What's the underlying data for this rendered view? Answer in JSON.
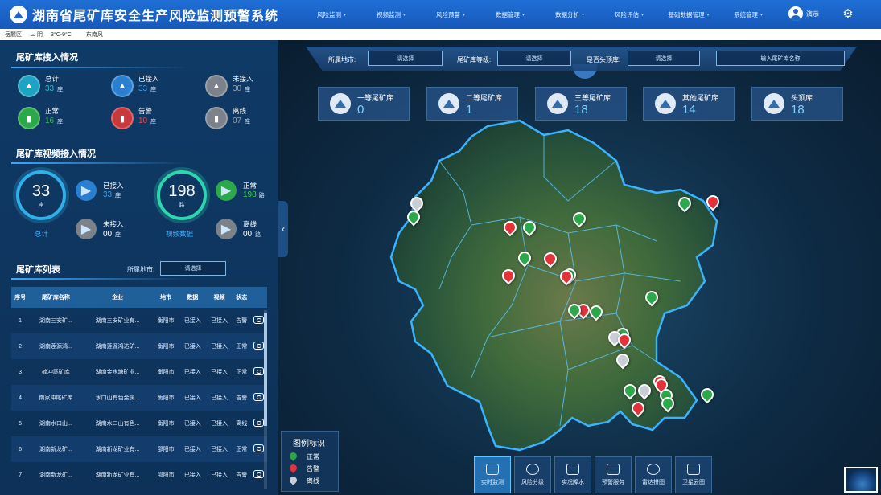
{
  "app": {
    "title": "湖南省尾矿库安全生产风险监测预警系统"
  },
  "nav": {
    "items": [
      {
        "label": "风险监测"
      },
      {
        "label": "视频监测"
      },
      {
        "label": "风险预警"
      },
      {
        "label": "数据管理"
      },
      {
        "label": "数据分析"
      },
      {
        "label": "风险评估"
      },
      {
        "label": "基础数据管理"
      },
      {
        "label": "系统管理"
      }
    ],
    "user": "演示"
  },
  "weather": {
    "region": "岳麓区",
    "condition": "阴",
    "temp": "3°C-9°C",
    "wind": "东南风"
  },
  "access": {
    "title": "尾矿库接入情况",
    "unit": "座",
    "stats": [
      {
        "label": "总计",
        "value": "33",
        "color": "#2fb8d6"
      },
      {
        "label": "已接入",
        "value": "33",
        "color": "#2a7fd0"
      },
      {
        "label": "未接入",
        "value": "30",
        "color": "#8a9099"
      },
      {
        "label": "正常",
        "value": "16",
        "color": "#2aa84a"
      },
      {
        "label": "告警",
        "value": "10",
        "color": "#c8383c"
      },
      {
        "label": "离线",
        "value": "07",
        "color": "#8a9099"
      }
    ]
  },
  "video": {
    "title": "尾矿库视频接入情况",
    "total_value": "33",
    "total_unit": "座",
    "total_label": "总计",
    "connected_label": "已接入",
    "connected_value": "33",
    "connected_unit": "座",
    "unconnected_label": "未接入",
    "unconnected_value": "00",
    "unconnected_unit": "座",
    "data_value": "198",
    "data_unit": "路",
    "data_label": "视频数据",
    "normal_label": "正常",
    "normal_value": "198",
    "normal_unit": "路",
    "offline_label": "离线",
    "offline_value": "00",
    "offline_unit": "路"
  },
  "list": {
    "title": "尾矿库列表",
    "filter_label": "所属地市:",
    "filter_placeholder": "请选择",
    "headers": [
      "序号",
      "尾矿库名称",
      "企业",
      "地市",
      "数据",
      "视频",
      "状态"
    ],
    "rows": [
      {
        "no": "1",
        "name": "湖南三安矿...",
        "company": "湖南三安矿业有...",
        "city": "衡阳市",
        "data": "已接入",
        "video": "已接入",
        "status": "告警"
      },
      {
        "no": "2",
        "name": "湖南莲源鸿...",
        "company": "湖南莲源鸿达矿...",
        "city": "衡阳市",
        "data": "已接入",
        "video": "已接入",
        "status": "正常"
      },
      {
        "no": "3",
        "name": "楠冲尾矿库",
        "company": "湖南金水塘矿业...",
        "city": "衡阳市",
        "data": "已接入",
        "video": "已接入",
        "status": "正常"
      },
      {
        "no": "4",
        "name": "南家冲尾矿库",
        "company": "水口山有色金属...",
        "city": "衡阳市",
        "data": "已接入",
        "video": "已接入",
        "status": "告警"
      },
      {
        "no": "5",
        "name": "湖南水口山...",
        "company": "湖南水口山有色...",
        "city": "衡阳市",
        "data": "已接入",
        "video": "已接入",
        "status": "离线"
      },
      {
        "no": "6",
        "name": "湖南新龙矿...",
        "company": "湖南新龙矿业有...",
        "city": "邵阳市",
        "data": "已接入",
        "video": "已接入",
        "status": "正常"
      },
      {
        "no": "7",
        "name": "湖南新龙矿...",
        "company": "湖南新龙矿业有...",
        "city": "邵阳市",
        "data": "已接入",
        "video": "已接入",
        "status": "告警"
      }
    ]
  },
  "mapfilter": {
    "city_label": "所属地市:",
    "city_placeholder": "请选择",
    "grade_label": "尾矿库等级:",
    "grade_placeholder": "请选择",
    "head_label": "是否头顶库:",
    "head_placeholder": "请选择",
    "name_placeholder": "输入尾矿库名称"
  },
  "categories": [
    {
      "label": "一等尾矿库",
      "value": "0"
    },
    {
      "label": "二等尾矿库",
      "value": "1"
    },
    {
      "label": "三等尾矿库",
      "value": "18"
    },
    {
      "label": "其他尾矿库",
      "value": "14"
    },
    {
      "label": "头顶库",
      "value": "18"
    }
  ],
  "legend": {
    "title": "图例标识",
    "items": [
      {
        "label": "正常",
        "color": "#2aa84a"
      },
      {
        "label": "告警",
        "color": "#e2323a"
      },
      {
        "label": "离线",
        "color": "#c9ced6"
      }
    ]
  },
  "bottom": {
    "buttons": [
      {
        "label": "实时监测",
        "active": true
      },
      {
        "label": "风险分级",
        "active": false
      },
      {
        "label": "实况降水",
        "active": false
      },
      {
        "label": "预警服务",
        "active": false
      },
      {
        "label": "雷达拼图",
        "active": false
      },
      {
        "label": "卫星云图",
        "active": false
      }
    ]
  },
  "markers": [
    {
      "status": "offline"
    },
    {
      "status": "normal"
    },
    {
      "status": "alert"
    },
    {
      "status": "normal"
    },
    {
      "status": "normal"
    },
    {
      "status": "normal"
    },
    {
      "status": "alert"
    },
    {
      "status": "normal"
    },
    {
      "status": "alert"
    },
    {
      "status": "normal"
    },
    {
      "status": "alert"
    },
    {
      "status": "alert"
    },
    {
      "status": "normal"
    },
    {
      "status": "alert"
    },
    {
      "status": "normal"
    },
    {
      "status": "normal"
    },
    {
      "status": "alert"
    },
    {
      "status": "normal"
    },
    {
      "status": "offline"
    },
    {
      "status": "alert"
    },
    {
      "status": "offline"
    },
    {
      "status": "normal"
    },
    {
      "status": "alert"
    },
    {
      "status": "alert"
    },
    {
      "status": "offline"
    },
    {
      "status": "normal"
    },
    {
      "status": "normal"
    },
    {
      "status": "alert"
    },
    {
      "status": "normal"
    }
  ]
}
